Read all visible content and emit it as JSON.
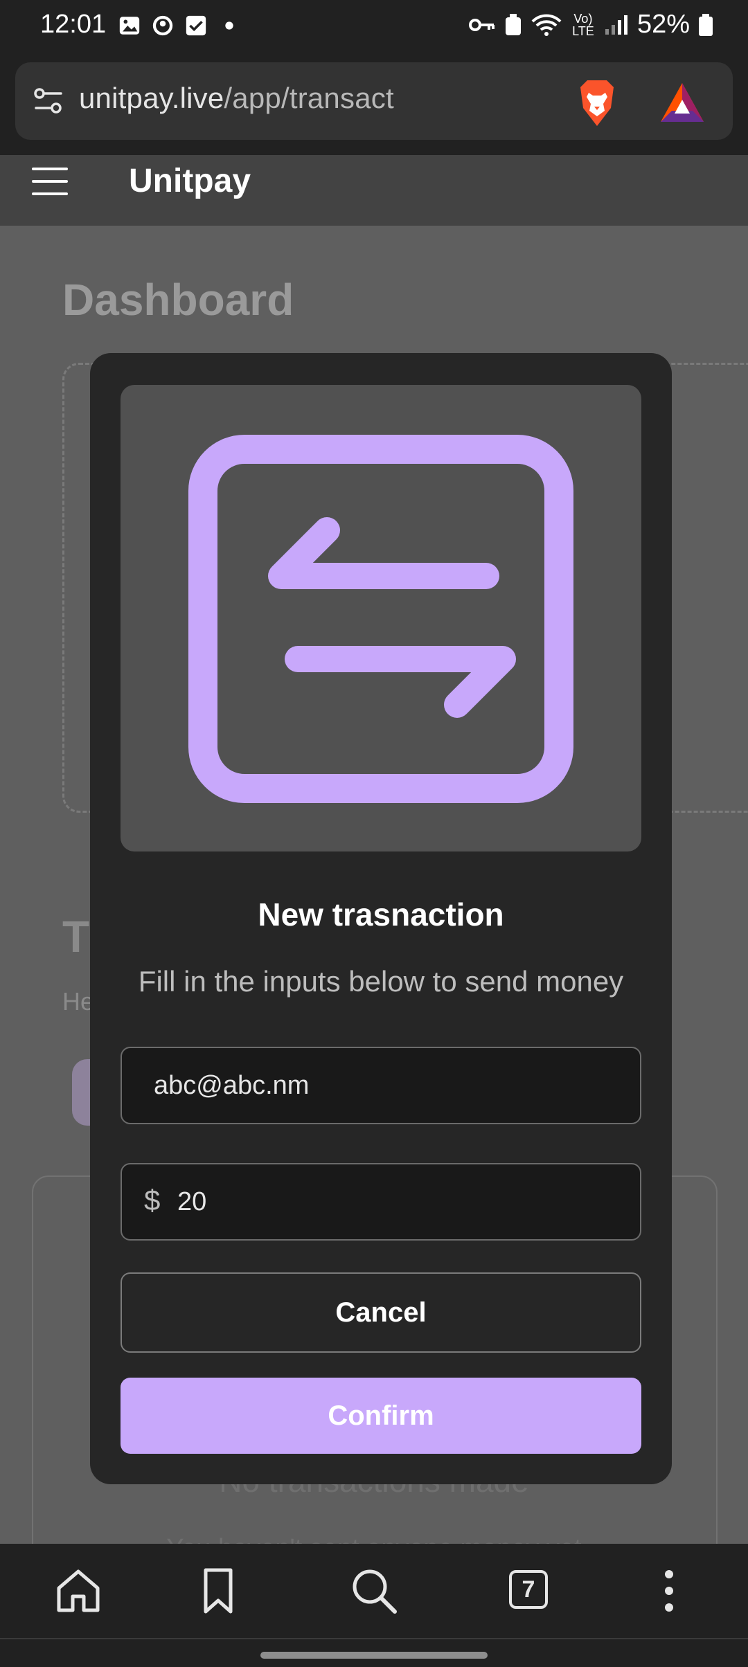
{
  "status_bar": {
    "time": "12:01",
    "battery": "52%",
    "network": "Vo) LTE"
  },
  "browser": {
    "url_host": "unitpay.live",
    "url_path": "/app/transact",
    "tab_count": "7"
  },
  "app": {
    "title": "Unitpay"
  },
  "page": {
    "heading": "Dashboard",
    "section_head_partial": "T",
    "section_sub_partial": "He",
    "empty_title": "No transactions made",
    "empty_subtitle": "You haven't sent anyone money yet"
  },
  "modal": {
    "title": "New trasnaction",
    "description": "Fill in the inputs below to send money",
    "email_value": "abc@abc.nm",
    "currency_symbol": "$",
    "amount_value": "20",
    "cancel_label": "Cancel",
    "confirm_label": "Confirm",
    "hero_icon": "transfer-arrows-icon",
    "accent_color": "#c8a8fb"
  },
  "toolbar": {
    "items": [
      "home-icon",
      "bookmark-icon",
      "search-icon",
      "tabs-button",
      "more-menu-icon"
    ]
  }
}
